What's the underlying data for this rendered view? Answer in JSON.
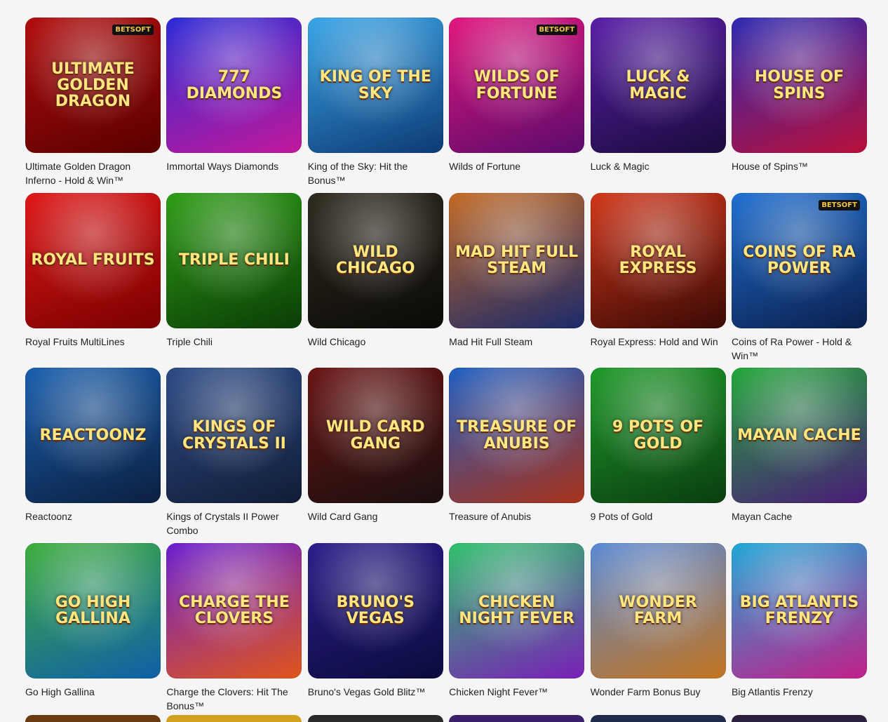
{
  "games": [
    {
      "label": "Ultimate Golden Dragon Inferno - Hold & Win™",
      "art": "ULTIMATE GOLDEN DRAGON",
      "badge": "BETSOFT",
      "colors": [
        "#b10d0d",
        "#5a0000"
      ]
    },
    {
      "label": "Immortal Ways Diamonds",
      "art": "777 DIAMONDS",
      "badge": "",
      "colors": [
        "#2b2bd6",
        "#c2189a"
      ]
    },
    {
      "label": "King of the Sky: Hit the Bonus™",
      "art": "KING OF THE SKY",
      "badge": "",
      "colors": [
        "#3aa6e8",
        "#0d3a74"
      ]
    },
    {
      "label": "Wilds of Fortune",
      "art": "WILDS OF FORTUNE",
      "badge": "BETSOFT",
      "colors": [
        "#e2177e",
        "#5b0b6b"
      ]
    },
    {
      "label": "Luck & Magic",
      "art": "LUCK & MAGIC",
      "badge": "",
      "colors": [
        "#5a1fa8",
        "#1a0b3d"
      ]
    },
    {
      "label": "House of Spins™",
      "art": "HOUSE OF SPINS",
      "badge": "",
      "colors": [
        "#2d2bb2",
        "#b80f3a"
      ]
    },
    {
      "label": "Royal Fruits MultiLines",
      "art": "ROYAL FRUITS",
      "badge": "",
      "colors": [
        "#e01818",
        "#7a0000"
      ]
    },
    {
      "label": "Triple Chili",
      "art": "TRIPLE CHILI",
      "badge": "",
      "colors": [
        "#2e9d16",
        "#0b3d06"
      ]
    },
    {
      "label": "Wild Chicago",
      "art": "WILD CHICAGO",
      "badge": "",
      "colors": [
        "#2f2a1f",
        "#0b0a07"
      ]
    },
    {
      "label": "Mad Hit Full Steam",
      "art": "MAD HIT FULL STEAM",
      "badge": "",
      "colors": [
        "#c46a25",
        "#1b2a6b"
      ]
    },
    {
      "label": "Royal Express: Hold and Win",
      "art": "ROYAL EXPRESS",
      "badge": "",
      "colors": [
        "#d1361a",
        "#3a0a05"
      ]
    },
    {
      "label": "Coins of Ra Power - Hold & Win™",
      "art": "COINS OF RA POWER",
      "badge": "BETSOFT",
      "colors": [
        "#1f6fd1",
        "#0b1f4d"
      ]
    },
    {
      "label": "Reactoonz",
      "art": "REACTOONZ",
      "badge": "",
      "colors": [
        "#1a5fae",
        "#0b1f40"
      ]
    },
    {
      "label": "Kings of Crystals II Power Combo",
      "art": "KINGS OF CRYSTALS II",
      "badge": "",
      "colors": [
        "#2d4b87",
        "#111d36"
      ]
    },
    {
      "label": "Wild Card Gang",
      "art": "WILD CARD GANG",
      "badge": "",
      "colors": [
        "#6a1414",
        "#1a0f0f"
      ]
    },
    {
      "label": "Treasure of Anubis",
      "art": "TREASURE OF ANUBIS",
      "badge": "",
      "colors": [
        "#1f5fc2",
        "#a8321a"
      ]
    },
    {
      "label": "9 Pots of Gold",
      "art": "9 POTS OF GOLD",
      "badge": "",
      "colors": [
        "#1f9a2a",
        "#0a3d10"
      ]
    },
    {
      "label": "Mayan Cache",
      "art": "MAYAN CACHE",
      "badge": "",
      "colors": [
        "#23a83a",
        "#4a1b78"
      ]
    },
    {
      "label": "Go High Gallina",
      "art": "GO HIGH GALLINA",
      "badge": "",
      "colors": [
        "#3fae3c",
        "#0f5fa8"
      ]
    },
    {
      "label": "Charge the Clovers: Hit The Bonus™",
      "art": "CHARGE THE CLOVERS",
      "badge": "",
      "colors": [
        "#6a1fd1",
        "#e0551a"
      ]
    },
    {
      "label": "Bruno's Vegas Gold Blitz™",
      "art": "BRUNO'S VEGAS",
      "badge": "",
      "colors": [
        "#2b1f8a",
        "#0b0b3d"
      ]
    },
    {
      "label": "Chicken Night Fever™",
      "art": "CHICKEN NIGHT FEVER",
      "badge": "",
      "colors": [
        "#2fc26b",
        "#7a1fb8"
      ]
    },
    {
      "label": "Wonder Farm Bonus Buy",
      "art": "WONDER FARM",
      "badge": "",
      "colors": [
        "#5a8ad6",
        "#c2741f"
      ]
    },
    {
      "label": "Big Atlantis Frenzy",
      "art": "BIG ATLANTIS FRENZY",
      "badge": "",
      "colors": [
        "#1fa8d6",
        "#c21f8a"
      ]
    }
  ],
  "peek_colors": [
    "#6a3a10",
    "#d1a11f",
    "#2a2a2a",
    "#3a1f6a",
    "#1f2a4d",
    "#2a1f3d"
  ]
}
